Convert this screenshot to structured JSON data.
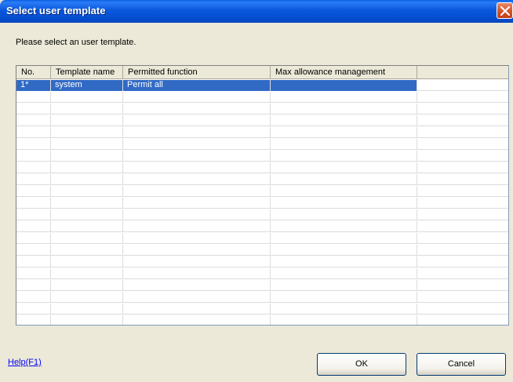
{
  "window": {
    "title": "Select user template"
  },
  "prompt": "Please select an user template.",
  "grid": {
    "columns": [
      "No.",
      "Template name",
      "Permitted function",
      "Max allowance management",
      ""
    ],
    "rows": [
      {
        "no": "1*",
        "template_name": "system",
        "permitted_function": "Permit all",
        "max_allowance": "",
        "extra": ""
      }
    ],
    "empty_row_count": 20,
    "selected_row": 0
  },
  "footer": {
    "help_label": "Help(F1)",
    "ok_label": "OK",
    "cancel_label": "Cancel"
  },
  "colors": {
    "titlebar": "#0550d4",
    "selection": "#316ac5",
    "dialog_bg": "#ece9d8",
    "link": "#0000ff"
  },
  "icons": {
    "close": "close-icon"
  }
}
